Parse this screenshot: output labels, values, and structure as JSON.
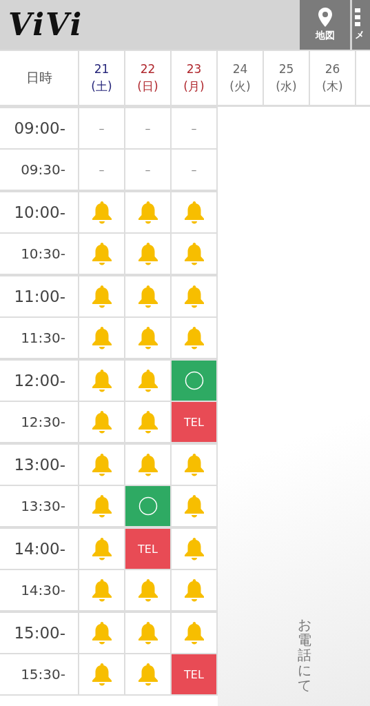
{
  "header": {
    "logo": "ViVi",
    "buttons": [
      {
        "kind": "map",
        "label": "地図"
      },
      {
        "kind": "menu",
        "label": "メ"
      }
    ]
  },
  "table": {
    "corner": "日時",
    "days": [
      {
        "date": "21",
        "weekday": "(土)",
        "color": "#26267a"
      },
      {
        "date": "22",
        "weekday": "(日)",
        "color": "#b0282e"
      },
      {
        "date": "23",
        "weekday": "(月)",
        "color": "#b0282e"
      },
      {
        "date": "24",
        "weekday": "(火)",
        "color": "#666666"
      },
      {
        "date": "25",
        "weekday": "(水)",
        "color": "#666666"
      },
      {
        "date": "26",
        "weekday": "(木)",
        "color": "#666666"
      }
    ],
    "rows": [
      {
        "time": "09:00-",
        "hour": true,
        "slots": [
          {
            "kind": "none",
            "text": "–"
          },
          {
            "kind": "none",
            "text": "–"
          },
          {
            "kind": "none",
            "text": "–"
          }
        ]
      },
      {
        "time": "09:30-",
        "hour": false,
        "slots": [
          {
            "kind": "none",
            "text": "–"
          },
          {
            "kind": "none",
            "text": "–"
          },
          {
            "kind": "none",
            "text": "–"
          }
        ]
      },
      {
        "time": "10:00-",
        "hour": true,
        "slots": [
          {
            "kind": "bell"
          },
          {
            "kind": "bell"
          },
          {
            "kind": "bell"
          }
        ]
      },
      {
        "time": "10:30-",
        "hour": false,
        "slots": [
          {
            "kind": "bell"
          },
          {
            "kind": "bell"
          },
          {
            "kind": "bell"
          }
        ]
      },
      {
        "time": "11:00-",
        "hour": true,
        "slots": [
          {
            "kind": "bell"
          },
          {
            "kind": "bell"
          },
          {
            "kind": "bell"
          }
        ]
      },
      {
        "time": "11:30-",
        "hour": false,
        "slots": [
          {
            "kind": "bell"
          },
          {
            "kind": "bell"
          },
          {
            "kind": "bell"
          }
        ]
      },
      {
        "time": "12:00-",
        "hour": true,
        "slots": [
          {
            "kind": "bell"
          },
          {
            "kind": "bell"
          },
          {
            "kind": "open"
          }
        ]
      },
      {
        "time": "12:30-",
        "hour": false,
        "slots": [
          {
            "kind": "bell"
          },
          {
            "kind": "bell"
          },
          {
            "kind": "tel",
            "text": "TEL"
          }
        ]
      },
      {
        "time": "13:00-",
        "hour": true,
        "slots": [
          {
            "kind": "bell"
          },
          {
            "kind": "bell"
          },
          {
            "kind": "bell"
          }
        ]
      },
      {
        "time": "13:30-",
        "hour": false,
        "slots": [
          {
            "kind": "bell"
          },
          {
            "kind": "open"
          },
          {
            "kind": "bell"
          }
        ]
      },
      {
        "time": "14:00-",
        "hour": true,
        "slots": [
          {
            "kind": "bell"
          },
          {
            "kind": "tel",
            "text": "TEL"
          },
          {
            "kind": "bell"
          }
        ]
      },
      {
        "time": "14:30-",
        "hour": false,
        "slots": [
          {
            "kind": "bell"
          },
          {
            "kind": "bell"
          },
          {
            "kind": "bell"
          }
        ]
      },
      {
        "time": "15:00-",
        "hour": true,
        "slots": [
          {
            "kind": "bell"
          },
          {
            "kind": "bell"
          },
          {
            "kind": "bell"
          }
        ]
      },
      {
        "time": "15:30-",
        "hour": false,
        "slots": [
          {
            "kind": "bell"
          },
          {
            "kind": "bell"
          },
          {
            "kind": "tel",
            "text": "TEL"
          }
        ]
      }
    ]
  },
  "side_note": "お電話にて"
}
